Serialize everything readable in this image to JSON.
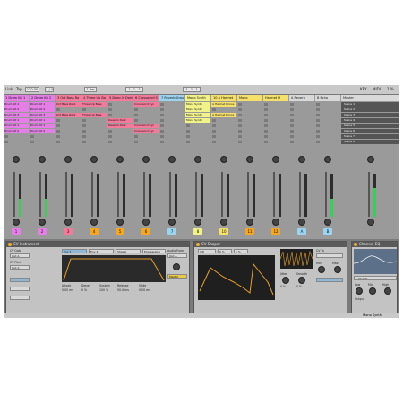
{
  "topbar": {
    "link": "Link",
    "tap": "Tap",
    "tempo": "120.00",
    "time_sig": "4 / 4",
    "loop_len": "1 Bar",
    "position": "1 . 1 . 1",
    "key": "KEY",
    "midi": "MIDI",
    "cpu": "1 %"
  },
  "tracks": [
    {
      "name": "1 Drum Kit 1",
      "color": "#e57ee6",
      "clips": [
        "Drum Kit 1",
        "Drum Kit 2",
        "Drum Kit 3",
        "Drum Kit 1",
        "Drum Kit 1",
        "Drum Kit 2"
      ],
      "num": "1",
      "numcolor": "#e57ee6"
    },
    {
      "name": "2 Drum Kit 2",
      "color": "#e57ee6",
      "clips": [
        "Drum Kit 1",
        "Drum Kit 2",
        "Drum Kit 3",
        "Drum Kit 1",
        "Drum Kit 1",
        "Drum Kit 2"
      ],
      "num": "2",
      "numcolor": "#e57ee6"
    },
    {
      "name": "3 Oct Bass Ra",
      "color": "#f27a9a",
      "clips": [
        "Oct Bass Rack",
        "",
        "Oct Bass Rack"
      ],
      "num": "3",
      "numcolor": "#f27a9a"
    },
    {
      "name": "4 Three Up Ba",
      "color": "#f27a9a",
      "clips": [
        "Three Up Bass",
        "",
        "Three Up Bass"
      ],
      "num": "4",
      "numcolor": "#f5a623"
    },
    {
      "name": "5 Deep In Dark",
      "color": "#f27a9a",
      "clips": [
        "",
        "",
        "",
        "Deep In Dark",
        "Deep In Dark"
      ],
      "num": "5",
      "numcolor": "#f5a623"
    },
    {
      "name": "6 Crossword S",
      "color": "#f27a9a",
      "clips": [
        "Crossword Syn",
        "",
        "",
        "",
        "Crossword Syn",
        "Crossword Syn"
      ],
      "num": "6",
      "numcolor": "#f5a623"
    },
    {
      "name": "7 Reverb Group",
      "color": "#9bd4f0",
      "clips": [],
      "num": "7",
      "numcolor": "#9bd4f0"
    },
    {
      "name": "Mono Synth",
      "color": "#f2f28a",
      "clips": [
        "Mono Synth",
        "Mono Synth",
        "Mono Synth",
        "Mono Synth"
      ],
      "num": "8",
      "numcolor": "#f2f28a"
    },
    {
      "name": "10 A Harmet",
      "color": "#f5e06b",
      "clips": [
        "A Harmet Prince",
        "",
        "A Harmet Prince"
      ],
      "num": "10",
      "numcolor": "#f5e06b"
    },
    {
      "name": "Mono",
      "color": "#f5e06b",
      "clips": [],
      "num": "11",
      "numcolor": "#f5a623"
    },
    {
      "name": "Harmet Pi",
      "color": "#f5e06b",
      "clips": [],
      "num": "12",
      "numcolor": "#f5a623"
    },
    {
      "name": "A Reverb",
      "color": "#d9d9d9",
      "clips": [],
      "num": "A",
      "numcolor": "#9bd4f0"
    },
    {
      "name": "B Echo",
      "color": "#d9d9d9",
      "clips": [],
      "num": "B",
      "numcolor": "#9bd4f0"
    },
    {
      "name": "Master",
      "color": "#d9d9d9",
      "clips": [],
      "num": "",
      "numcolor": "#bbb"
    }
  ],
  "master_label": "Master",
  "scenes": [
    "Scene 1",
    "Scene 2",
    "Scene 3",
    "Scene 4",
    "Scene 5",
    "Scene 6",
    "Scene 7",
    "Scene 8"
  ],
  "sends_label": "Sends",
  "devices": {
    "inst": {
      "title": "CV Instrument",
      "cv_gate": "CV Gate",
      "cv_pitch": "CV Pitch",
      "out_a": "Out A",
      "audio_from": "Audio From",
      "env1": "Env 1",
      "env2": "Env 2",
      "shaper": "Shaper",
      "expressions": "Expressions",
      "attack": "Attack",
      "attack_v": "5.00 ms",
      "decay": "Decay",
      "decay_v": "0 %",
      "sustain": "Sustain",
      "sustain_v": "100 %",
      "release": "Release",
      "release_v": "50.0 ms",
      "glide": "Glide",
      "glide_v": "0.00 ms",
      "master": "Master"
    },
    "shaper": {
      "title": "CV Shaper",
      "rate": "1/8",
      "amount": "0 %",
      "mod": "1 %",
      "sync": "Sync",
      "offset": "Offset",
      "jitter": "Jitter",
      "jitter_v": "0 %",
      "smooth": "Smooth",
      "smooth_v": "0 %",
      "cv_to": "CV To",
      "min": "Min",
      "max": "Max"
    },
    "eq": {
      "title": "Channel EQ",
      "freq": "1.00 kHz",
      "low": "Low",
      "mid": "Mid",
      "high": "High",
      "output": "Output"
    }
  },
  "status": "Mono Synth"
}
